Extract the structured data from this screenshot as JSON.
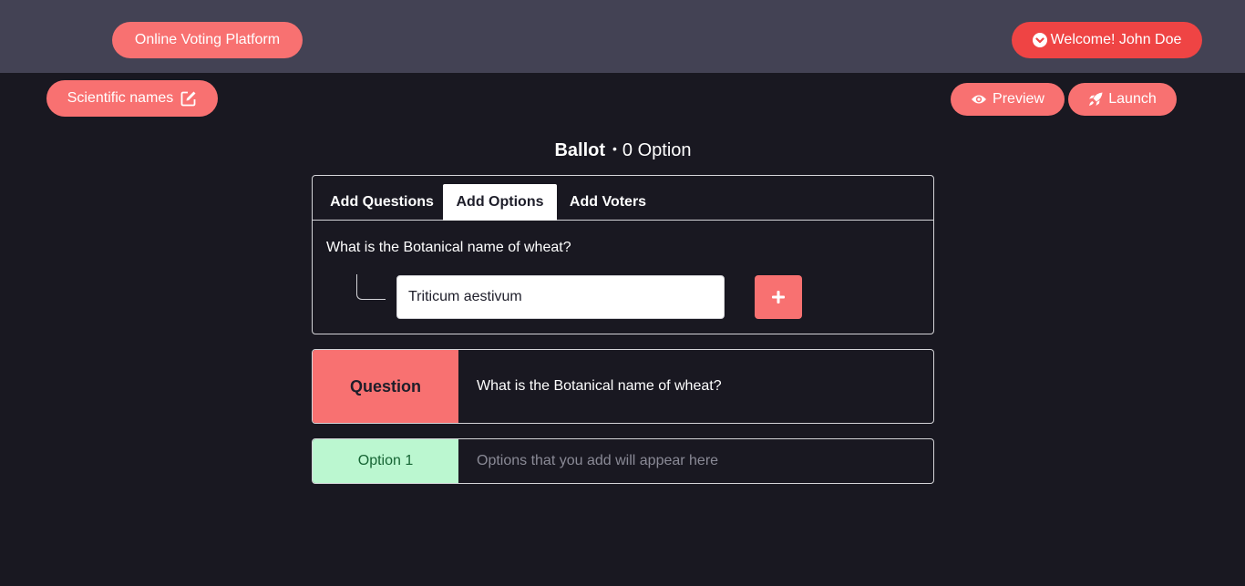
{
  "header": {
    "brand": "Online Voting Platform",
    "welcome": "Welcome! John Doe"
  },
  "ballot": {
    "name": "Scientific names",
    "preview_label": "Preview",
    "launch_label": "Launch",
    "title": "Ballot",
    "option_count": "0 Option"
  },
  "tabs": [
    {
      "label": "Add Questions"
    },
    {
      "label": "Add Options"
    },
    {
      "label": "Add Voters"
    }
  ],
  "add_options": {
    "question": "What is the Botanical name of wheat?",
    "input_value": "Triticum aestivum"
  },
  "question_row": {
    "label": "Question",
    "text": "What is the Botanical name of wheat?"
  },
  "option_row": {
    "label": "Option 1",
    "placeholder": "Options that you add will appear here"
  },
  "colors": {
    "accent": "#f87171",
    "welcome": "#ef4444",
    "topbar": "#434254",
    "background": "#191821",
    "option_badge": "#bbf7d0"
  },
  "icons": {
    "welcome": "chevron-circle-down-icon",
    "edit": "edit-icon",
    "preview": "eye-icon",
    "launch": "rocket-icon",
    "add": "plus-icon"
  }
}
